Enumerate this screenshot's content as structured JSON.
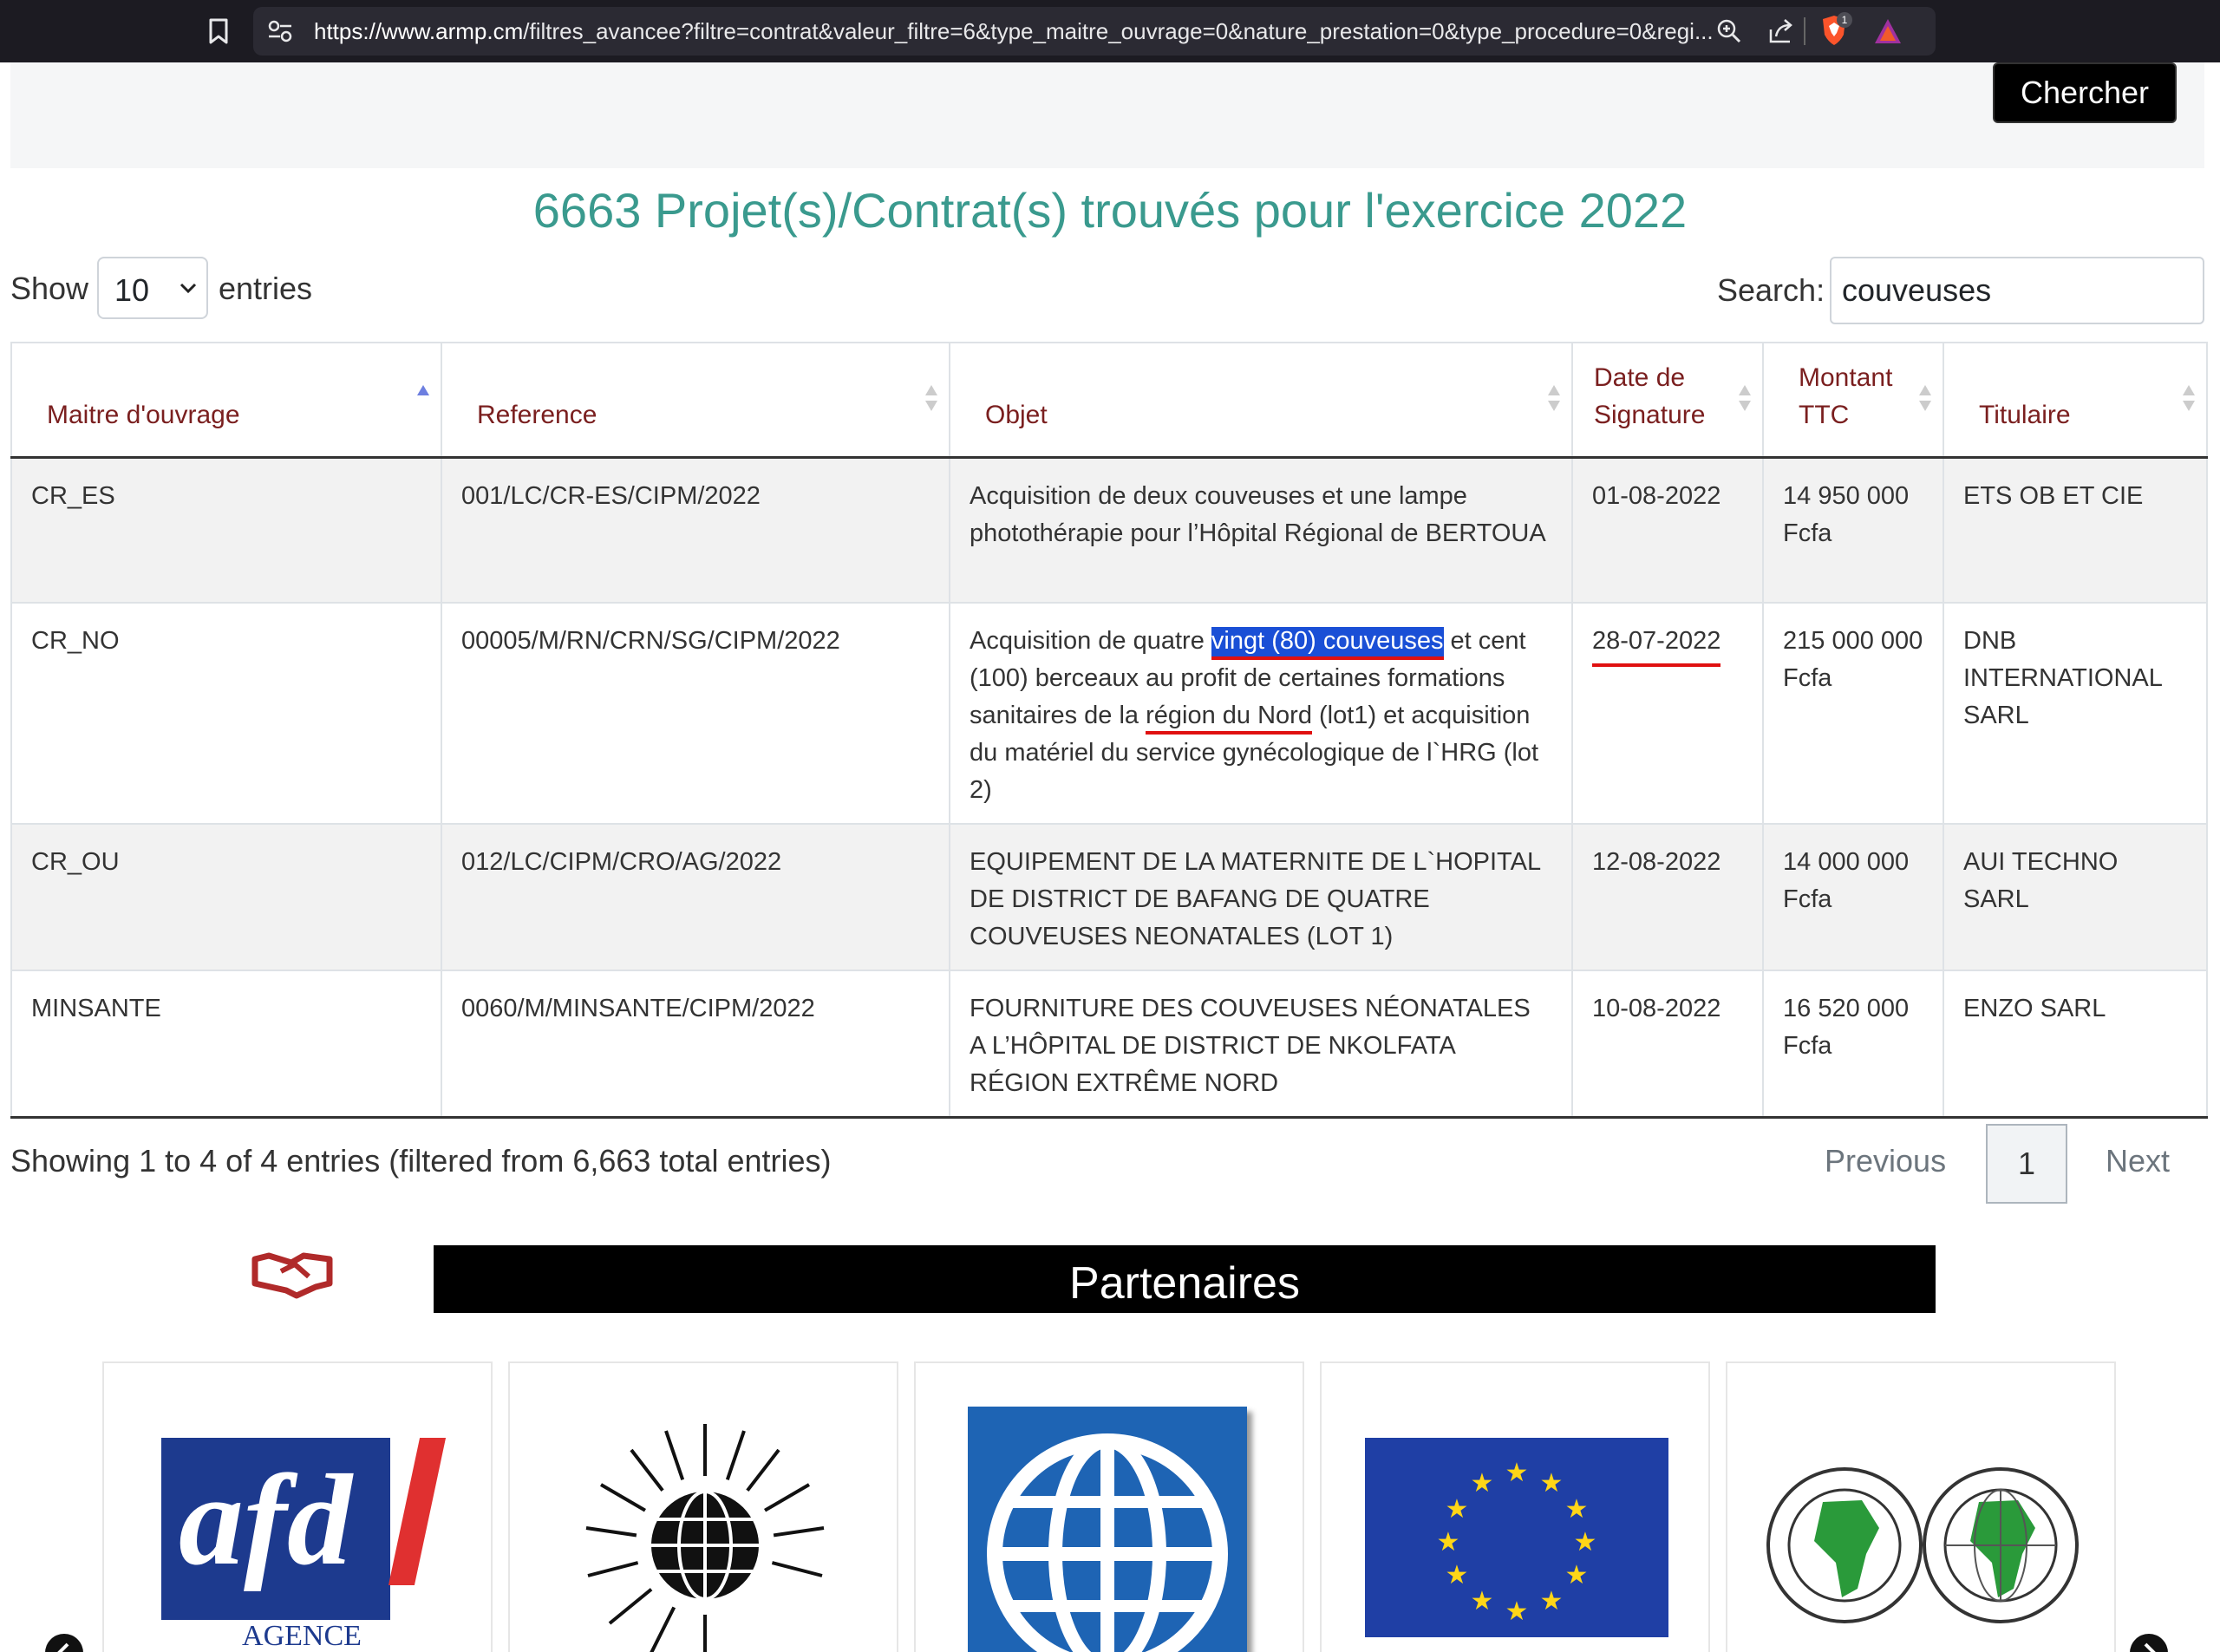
{
  "browser": {
    "url_host": "https://www.armp.cm",
    "url_path": "/filtres_avancee?filtre=contrat&valeur_filtre=6&type_maitre_ouvrage=0&nature_prestation=0&type_procedure=0&regi...",
    "badge_count": "1"
  },
  "toolbar": {
    "search_button_label": "Chercher"
  },
  "page_title": "6663 Projet(s)/Contrat(s) trouvés pour l'exercice 2022",
  "controls": {
    "show_label": "Show",
    "entries_value": "10",
    "entries_label": "entries",
    "search_label": "Search:",
    "search_value": "couveuses"
  },
  "table": {
    "headers": [
      "Maitre d'ouvrage",
      "Reference",
      "Objet",
      "Date de Signature",
      "Montant TTC",
      "Titulaire"
    ],
    "rows": [
      {
        "maitre": "CR_ES",
        "reference": "001/LC/CR-ES/CIPM/2022",
        "objet": "Acquisition de deux couveuses et une lampe photothérapie pour l’Hôpital Régional de BERTOUA",
        "date": "01-08-2022",
        "montant": "14 950 000 Fcfa",
        "titulaire": "ETS OB ET CIE"
      },
      {
        "maitre": "CR_NO",
        "reference": "00005/M/RN/CRN/SG/CIPM/2022",
        "objet_part1": "Acquisition de quatre ",
        "objet_highlight": "vingt (80) couveuses",
        "objet_part2": " et cent (100) berceaux au profit de certaines formations sanitaires de la ",
        "objet_underline": "région du Nord",
        "objet_part3": " (lot1) et acquisition du matériel du service gynécologique de l`HRG (lot 2)",
        "date": "28-07-2022",
        "montant": "215 000 000 Fcfa",
        "titulaire": "DNB INTERNATIONAL SARL"
      },
      {
        "maitre": "CR_OU",
        "reference": "012/LC/CIPM/CRO/AG/2022",
        "objet": "EQUIPEMENT DE LA MATERNITE DE L`HOPITAL DE DISTRICT DE BAFANG DE QUATRE COUVEUSES NEONATALES (LOT 1)",
        "date": "12-08-2022",
        "montant": "14 000 000 Fcfa",
        "titulaire": "AUI TECHNO SARL"
      },
      {
        "maitre": "MINSANTE",
        "reference": "0060/M/MINSANTE/CIPM/2022",
        "objet": "FOURNITURE DES COUVEUSES NÉONATALES A L’HÔPITAL DE DISTRICT DE NKOLFATA RÉGION EXTRÊME NORD",
        "date": "10-08-2022",
        "montant": "16 520 000 Fcfa",
        "titulaire": "ENZO SARL"
      }
    ]
  },
  "table_info": "Showing 1 to 4 of 4 entries (filtered from 6,663 total entries)",
  "pagination": {
    "previous": "Previous",
    "page": "1",
    "next": "Next"
  },
  "partners": {
    "title": "Partenaires",
    "afd_logo_text": "afd",
    "afd_caption": "AGENCE FRANÇAISE"
  },
  "icons": {
    "bookmark": "bookmark-icon",
    "site": "site-settings-icon",
    "zoom": "zoom-icon",
    "share": "share-icon",
    "brave": "brave-shields-icon",
    "rewards": "brave-rewards-icon",
    "chevron": "chevron-down-icon",
    "sort": "sort-icon",
    "handshake": "handshake-icon"
  },
  "colors": {
    "title": "#3a9a8e",
    "header_text": "#7a1f1f",
    "highlight": "#1a4fd6",
    "annotation_red": "#e01010"
  }
}
